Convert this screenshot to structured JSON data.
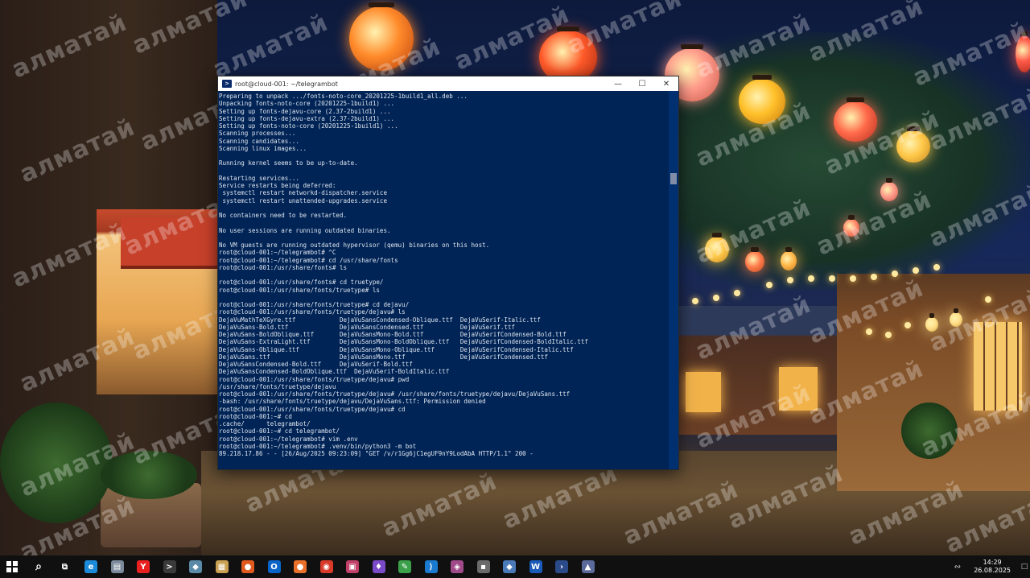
{
  "desktop": {
    "watermark_text": "алматай"
  },
  "terminal": {
    "title": "root@cloud-001: ~/telegrambot",
    "lines": [
      "Preparing to unpack .../fonts-noto-core_20201225-1build1_all.deb ...",
      "Unpacking fonts-noto-core (20201225-1build1) ...",
      "Setting up fonts-dejavu-core (2.37-2build1) ...",
      "Setting up fonts-dejavu-extra (2.37-2build1) ...",
      "Setting up fonts-noto-core (20201225-1build1) ...",
      "Scanning processes...",
      "Scanning candidates...",
      "Scanning linux images...",
      "",
      "Running kernel seems to be up-to-date.",
      "",
      "Restarting services...",
      "Service restarts being deferred:",
      " systemctl restart networkd-dispatcher.service",
      " systemctl restart unattended-upgrades.service",
      "",
      "No containers need to be restarted.",
      "",
      "No user sessions are running outdated binaries.",
      "",
      "No VM guests are running outdated hypervisor (qemu) binaries on this host.",
      "root@cloud-001:~/telegrambot# ^C",
      "root@cloud-001:~/telegrambot# cd /usr/share/fonts",
      "root@cloud-001:/usr/share/fonts# ls",
      "",
      "root@cloud-001:/usr/share/fonts# cd truetype/",
      "root@cloud-001:/usr/share/fonts/truetype# ls",
      "",
      "root@cloud-001:/usr/share/fonts/truetype# cd dejavu/",
      "root@cloud-001:/usr/share/fonts/truetype/dejavu# ls",
      "DejaVuMathTeXGyre.ttf            DejaVuSansCondensed-Oblique.ttf  DejaVuSerif-Italic.ttf",
      "DejaVuSans-Bold.ttf              DejaVuSansCondensed.ttf          DejaVuSerif.ttf",
      "DejaVuSans-BoldOblique.ttf       DejaVuSansMono-Bold.ttf          DejaVuSerifCondensed-Bold.ttf",
      "DejaVuSans-ExtraLight.ttf        DejaVuSansMono-BoldOblique.ttf   DejaVuSerifCondensed-BoldItalic.ttf",
      "DejaVuSans-Oblique.ttf           DejaVuSansMono-Oblique.ttf       DejaVuSerifCondensed-Italic.ttf",
      "DejaVuSans.ttf                   DejaVuSansMono.ttf               DejaVuSerifCondensed.ttf",
      "DejaVuSansCondensed-Bold.ttf     DejaVuSerif-Bold.ttf",
      "DejaVuSansCondensed-BoldOblique.ttf  DejaVuSerif-BoldItalic.ttf",
      "root@cloud-001:/usr/share/fonts/truetype/dejavu# pwd",
      "/usr/share/fonts/truetype/dejavu",
      "root@cloud-001:/usr/share/fonts/truetype/dejavu# /usr/share/fonts/truetype/dejavu/DejaVuSans.ttf",
      "-bash: /usr/share/fonts/truetype/dejavu/DejaVuSans.ttf: Permission denied",
      "root@cloud-001:/usr/share/fonts/truetype/dejavu# cd",
      "root@cloud-001:~# cd",
      ".cache/      telegrambot/",
      "root@cloud-001:~# cd telegrambot/",
      "root@cloud-001:~/telegrambot# vim .env",
      "root@cloud-001:~/telegrambot# .venv/bin/python3 -m bot",
      "89.218.17.86 - - [26/Aug/2025 09:23:09] \"GET /v/r1Gg6jC1egUF9nY9LodAbA HTTP/1.1\" 200 -"
    ]
  },
  "taskbar": {
    "icons": [
      {
        "name": "search-icon",
        "glyph": "⌕",
        "color": "#101010"
      },
      {
        "name": "task-view-icon",
        "glyph": "⧉",
        "color": "#101010"
      },
      {
        "name": "edge-icon",
        "glyph": "e",
        "color": "#1b8ad8"
      },
      {
        "name": "file-explorer-icon",
        "glyph": "▤",
        "color": "#7a8a9a"
      },
      {
        "name": "yandex-browser-icon",
        "glyph": "Y",
        "color": "#e82020"
      },
      {
        "name": "terminal-icon",
        "glyph": ">",
        "color": "#3a3a3a"
      },
      {
        "name": "app-icon-1",
        "glyph": "◆",
        "color": "#5a8aa8"
      },
      {
        "name": "photos-icon",
        "glyph": "▦",
        "color": "#c8a050"
      },
      {
        "name": "app-icon-2",
        "glyph": "●",
        "color": "#e05a20"
      },
      {
        "name": "outlook-icon",
        "glyph": "O",
        "color": "#0a64c8"
      },
      {
        "name": "firefox-icon",
        "glyph": "●",
        "color": "#e8702a"
      },
      {
        "name": "chrome-icon",
        "glyph": "◉",
        "color": "#d83a2a"
      },
      {
        "name": "app-icon-3",
        "glyph": "▣",
        "color": "#c0406a"
      },
      {
        "name": "app-icon-4",
        "glyph": "♦",
        "color": "#7a4ac8"
      },
      {
        "name": "notepad-icon",
        "glyph": "✎",
        "color": "#3aa04a"
      },
      {
        "name": "vscode-icon",
        "glyph": "⟩",
        "color": "#1a7ad0"
      },
      {
        "name": "app-icon-5",
        "glyph": "◈",
        "color": "#a04a8a"
      },
      {
        "name": "app-icon-6",
        "glyph": "▪",
        "color": "#6a6a6a"
      },
      {
        "name": "app-icon-7",
        "glyph": "◆",
        "color": "#4a7ab8"
      },
      {
        "name": "word-icon",
        "glyph": "W",
        "color": "#1a5ab8"
      },
      {
        "name": "powershell-icon",
        "glyph": "›",
        "color": "#2a4a8a"
      },
      {
        "name": "app-icon-8",
        "glyph": "▲",
        "color": "#5a6a9a"
      }
    ],
    "clock_time": "14:29",
    "clock_date": "26.08.2025"
  }
}
